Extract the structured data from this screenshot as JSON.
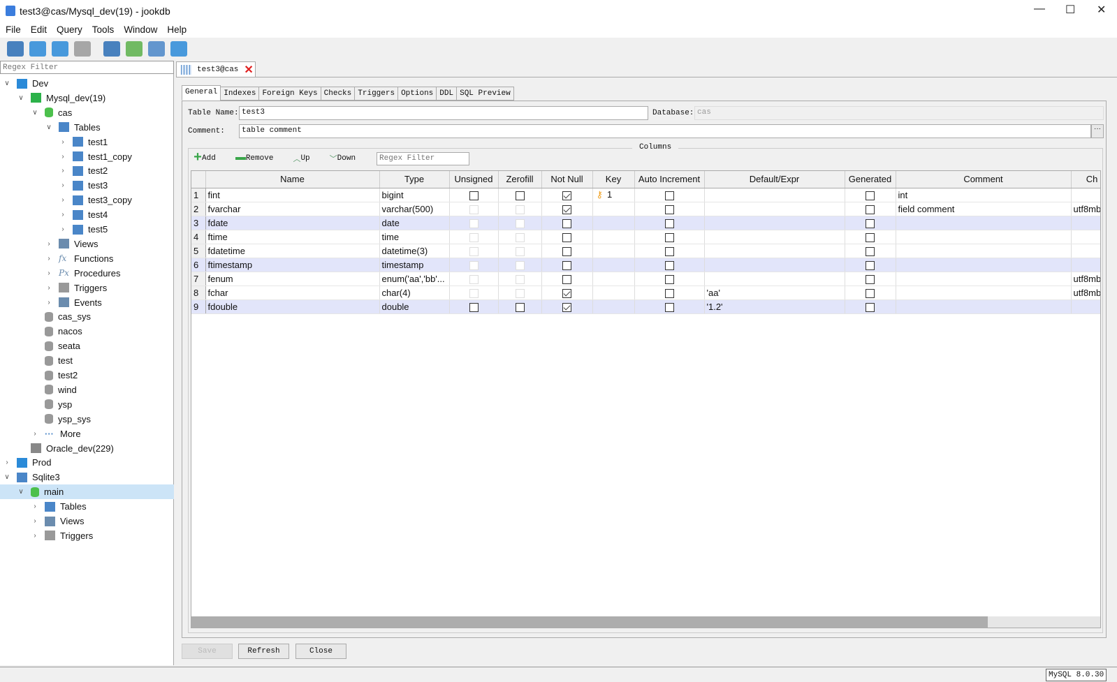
{
  "window": {
    "title": "test3@cas/Mysql_dev(19) - jookdb",
    "minimize": "—",
    "maximize": "☐",
    "close": "✕"
  },
  "menu": [
    "File",
    "Edit",
    "Query",
    "Tools",
    "Window",
    "Help"
  ],
  "toolbar": [
    "connect-icon",
    "new-query-icon",
    "open-folder-icon",
    "save-icon",
    "find-icon",
    "user-icon",
    "wand-icon",
    "notes-icon"
  ],
  "sidebar": {
    "filter_placeholder": "Regex Filter",
    "tree": [
      {
        "label": "Dev",
        "level": 0,
        "exp": "open",
        "icon": "folder",
        "color": "#2a8ad8"
      },
      {
        "label": "Mysql_dev(19)",
        "level": 1,
        "exp": "open",
        "icon": "mysql",
        "color": "#2cb24a"
      },
      {
        "label": "cas",
        "level": 2,
        "exp": "open",
        "icon": "db",
        "color": "#4cc04c"
      },
      {
        "label": "Tables",
        "level": 3,
        "exp": "open",
        "icon": "table",
        "color": "#4a86c8"
      },
      {
        "label": "test1",
        "level": 4,
        "exp": "closed",
        "icon": "table",
        "color": "#4a86c8"
      },
      {
        "label": "test1_copy",
        "level": 4,
        "exp": "closed",
        "icon": "table",
        "color": "#4a86c8"
      },
      {
        "label": "test2",
        "level": 4,
        "exp": "closed",
        "icon": "table",
        "color": "#4a86c8"
      },
      {
        "label": "test3",
        "level": 4,
        "exp": "closed",
        "icon": "table",
        "color": "#4a86c8"
      },
      {
        "label": "test3_copy",
        "level": 4,
        "exp": "closed",
        "icon": "table",
        "color": "#4a86c8"
      },
      {
        "label": "test4",
        "level": 4,
        "exp": "closed",
        "icon": "table",
        "color": "#4a86c8"
      },
      {
        "label": "test5",
        "level": 4,
        "exp": "closed",
        "icon": "table",
        "color": "#4a86c8"
      },
      {
        "label": "Views",
        "level": 3,
        "exp": "closed",
        "icon": "views",
        "color": "#6b8cae"
      },
      {
        "label": "Functions",
        "level": 3,
        "exp": "closed",
        "icon": "fx",
        "color": "#6b8cae"
      },
      {
        "label": "Procedures",
        "level": 3,
        "exp": "closed",
        "icon": "px",
        "color": "#6b8cae"
      },
      {
        "label": "Triggers",
        "level": 3,
        "exp": "closed",
        "icon": "trigger",
        "color": "#999"
      },
      {
        "label": "Events",
        "level": 3,
        "exp": "closed",
        "icon": "events",
        "color": "#6b8cae"
      },
      {
        "label": "cas_sys",
        "level": 2,
        "exp": "none",
        "icon": "db",
        "color": "#999"
      },
      {
        "label": "nacos",
        "level": 2,
        "exp": "none",
        "icon": "db",
        "color": "#999"
      },
      {
        "label": "seata",
        "level": 2,
        "exp": "none",
        "icon": "db",
        "color": "#999"
      },
      {
        "label": "test",
        "level": 2,
        "exp": "none",
        "icon": "db",
        "color": "#999"
      },
      {
        "label": "test2",
        "level": 2,
        "exp": "none",
        "icon": "db",
        "color": "#999"
      },
      {
        "label": "wind",
        "level": 2,
        "exp": "none",
        "icon": "db",
        "color": "#999"
      },
      {
        "label": "ysp",
        "level": 2,
        "exp": "none",
        "icon": "db",
        "color": "#999"
      },
      {
        "label": "ysp_sys",
        "level": 2,
        "exp": "none",
        "icon": "db",
        "color": "#999"
      },
      {
        "label": "More",
        "level": 2,
        "exp": "closed",
        "icon": "more",
        "color": "#4a86c8"
      },
      {
        "label": "Oracle_dev(229)",
        "level": 1,
        "exp": "none",
        "icon": "oracle",
        "color": "#888"
      },
      {
        "label": "Prod",
        "level": 0,
        "exp": "closed",
        "icon": "folder",
        "color": "#2a8ad8"
      },
      {
        "label": "Sqlite3",
        "level": 0,
        "exp": "open",
        "icon": "sqlite",
        "color": "#4a86c8"
      },
      {
        "label": "main",
        "level": 1,
        "exp": "open",
        "icon": "db",
        "color": "#4cc04c",
        "selected": true
      },
      {
        "label": "Tables",
        "level": 2,
        "exp": "closed",
        "icon": "table",
        "color": "#4a86c8"
      },
      {
        "label": "Views",
        "level": 2,
        "exp": "closed",
        "icon": "views",
        "color": "#6b8cae"
      },
      {
        "label": "Triggers",
        "level": 2,
        "exp": "closed",
        "icon": "trigger",
        "color": "#999"
      }
    ]
  },
  "tab": {
    "label": "test3@cas"
  },
  "subtabs": [
    "General",
    "Indexes",
    "Foreign Keys",
    "Checks",
    "Triggers",
    "Options",
    "DDL",
    "SQL Preview"
  ],
  "form": {
    "table_name_label": "Table Name:",
    "table_name": "test3",
    "database_label": "Database:",
    "database": "cas",
    "comment_label": "Comment:",
    "comment": "table comment",
    "more_button": "···"
  },
  "columns": {
    "legend": "Columns",
    "add": "Add",
    "remove": "Remove",
    "up": "Up",
    "down": "Down",
    "filter_placeholder": "Regex Filter",
    "headers": [
      "",
      "Name",
      "Type",
      "Unsigned",
      "Zerofill",
      "Not Null",
      "Key",
      "Auto Increment",
      "Default/Expr",
      "Generated",
      "Comment",
      "Ch"
    ],
    "rows": [
      {
        "n": "1",
        "name": "fint",
        "type": "bigint",
        "unsigned": "off",
        "zerofill": "off",
        "notnull": "on",
        "key": "1",
        "ai": "off",
        "def": "",
        "gen": "off",
        "comment": "int",
        "ch": "",
        "hl": false
      },
      {
        "n": "2",
        "name": "fvarchar",
        "type": "varchar(500)",
        "unsigned": "dis",
        "zerofill": "dis",
        "notnull": "on",
        "key": "",
        "ai": "off",
        "def": "",
        "gen": "off",
        "comment": "field comment",
        "ch": "utf8mb",
        "hl": false
      },
      {
        "n": "3",
        "name": "fdate",
        "type": "date",
        "unsigned": "dis",
        "zerofill": "dis",
        "notnull": "off",
        "key": "",
        "ai": "off",
        "def": "",
        "gen": "off",
        "comment": "",
        "ch": "",
        "hl": true
      },
      {
        "n": "4",
        "name": "ftime",
        "type": "time",
        "unsigned": "dis",
        "zerofill": "dis",
        "notnull": "off",
        "key": "",
        "ai": "off",
        "def": "",
        "gen": "off",
        "comment": "",
        "ch": "",
        "hl": false
      },
      {
        "n": "5",
        "name": "fdatetime",
        "type": "datetime(3)",
        "unsigned": "dis",
        "zerofill": "dis",
        "notnull": "off",
        "key": "",
        "ai": "off",
        "def": "",
        "gen": "off",
        "comment": "",
        "ch": "",
        "hl": false
      },
      {
        "n": "6",
        "name": "ftimestamp",
        "type": "timestamp",
        "unsigned": "dis",
        "zerofill": "dis",
        "notnull": "off",
        "key": "",
        "ai": "off",
        "def": "",
        "gen": "off",
        "comment": "",
        "ch": "",
        "hl": true
      },
      {
        "n": "7",
        "name": "fenum",
        "type": "enum('aa','bb'...",
        "unsigned": "dis",
        "zerofill": "dis",
        "notnull": "off",
        "key": "",
        "ai": "off",
        "def": "",
        "gen": "off",
        "comment": "",
        "ch": "utf8mb",
        "hl": false
      },
      {
        "n": "8",
        "name": "fchar",
        "type": "char(4)",
        "unsigned": "dis",
        "zerofill": "dis",
        "notnull": "on",
        "key": "",
        "ai": "off",
        "def": "'aa'",
        "gen": "off",
        "comment": "",
        "ch": "utf8mb",
        "hl": false
      },
      {
        "n": "9",
        "name": "fdouble",
        "type": "double",
        "unsigned": "off",
        "zerofill": "off",
        "notnull": "on",
        "key": "",
        "ai": "off",
        "def": "'1.2'",
        "gen": "off",
        "comment": "",
        "ch": "",
        "hl": true
      }
    ]
  },
  "buttons": {
    "save": "Save",
    "refresh": "Refresh",
    "close": "Close"
  },
  "status": {
    "server": "MySQL 8.0.30"
  }
}
